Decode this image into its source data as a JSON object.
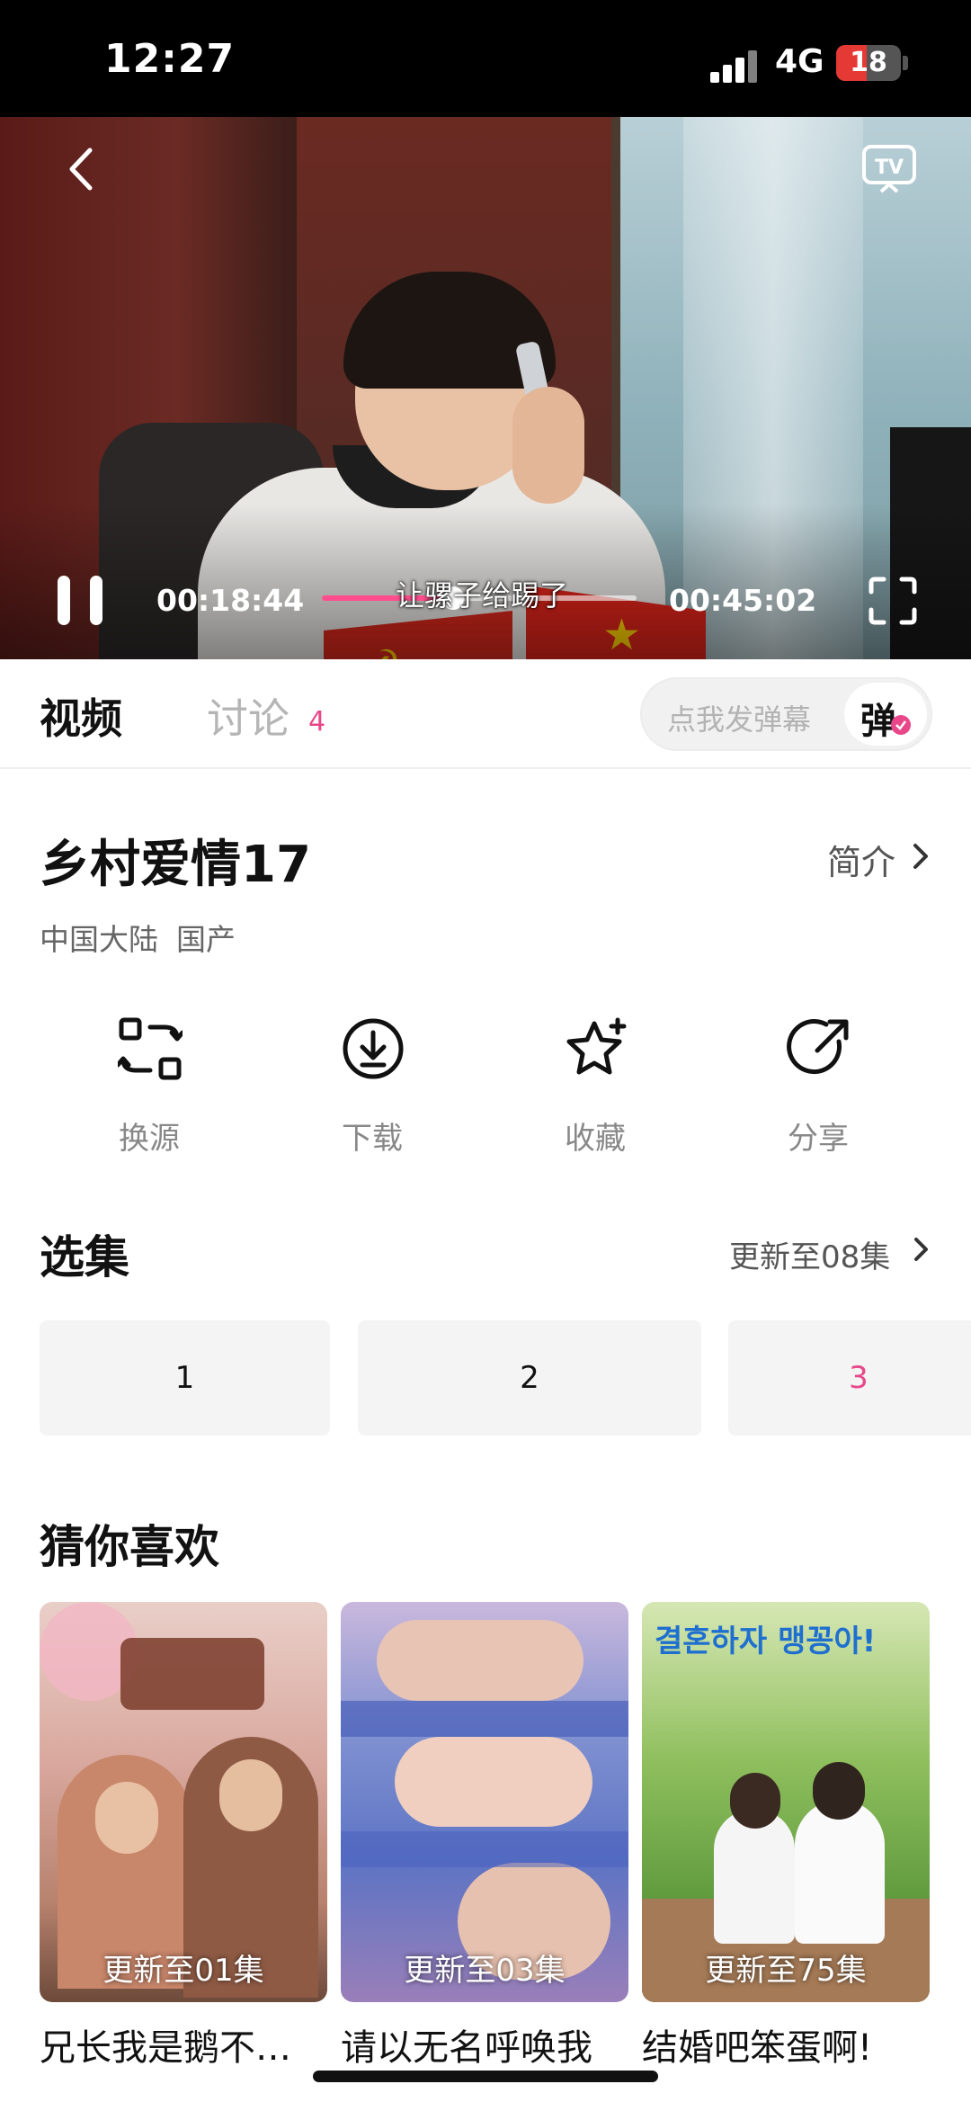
{
  "status_bar": {
    "time": "12:27",
    "network": "4G",
    "battery": "18"
  },
  "player": {
    "current_time": "00:18:44",
    "total_time": "00:45:02",
    "progress": 0.416,
    "subtitle": "让骡子给踢了"
  },
  "tabs": {
    "video": "视频",
    "discuss": "讨论",
    "discuss_count": "4"
  },
  "danmu": {
    "placeholder": "点我发弹幕",
    "button": "弹"
  },
  "show": {
    "title": "乡村爱情17",
    "intro_label": "简介",
    "region": "中国大陆",
    "origin": "国产"
  },
  "actions": [
    {
      "label": "换源",
      "icon": "switch-source-icon"
    },
    {
      "label": "下载",
      "icon": "download-icon"
    },
    {
      "label": "收藏",
      "icon": "favorite-star-icon"
    },
    {
      "label": "分享",
      "icon": "share-icon"
    }
  ],
  "episodes": {
    "title": "选集",
    "update": "更新至08集",
    "items": [
      "1",
      "2",
      "3"
    ],
    "active_index": 2
  },
  "recommend": {
    "title": "猜你喜欢",
    "items": [
      {
        "title": "兄长我是鹅不…",
        "badge": "更新至01集"
      },
      {
        "title": "请以无名呼唤我",
        "badge": "更新至03集"
      },
      {
        "title": "结婚吧笨蛋啊!",
        "badge": "更新至75集",
        "poster_text": "결혼하자 맹꽁아!"
      }
    ]
  },
  "colors": {
    "accent": "#e8488a",
    "progress": "#ff4d8d"
  }
}
